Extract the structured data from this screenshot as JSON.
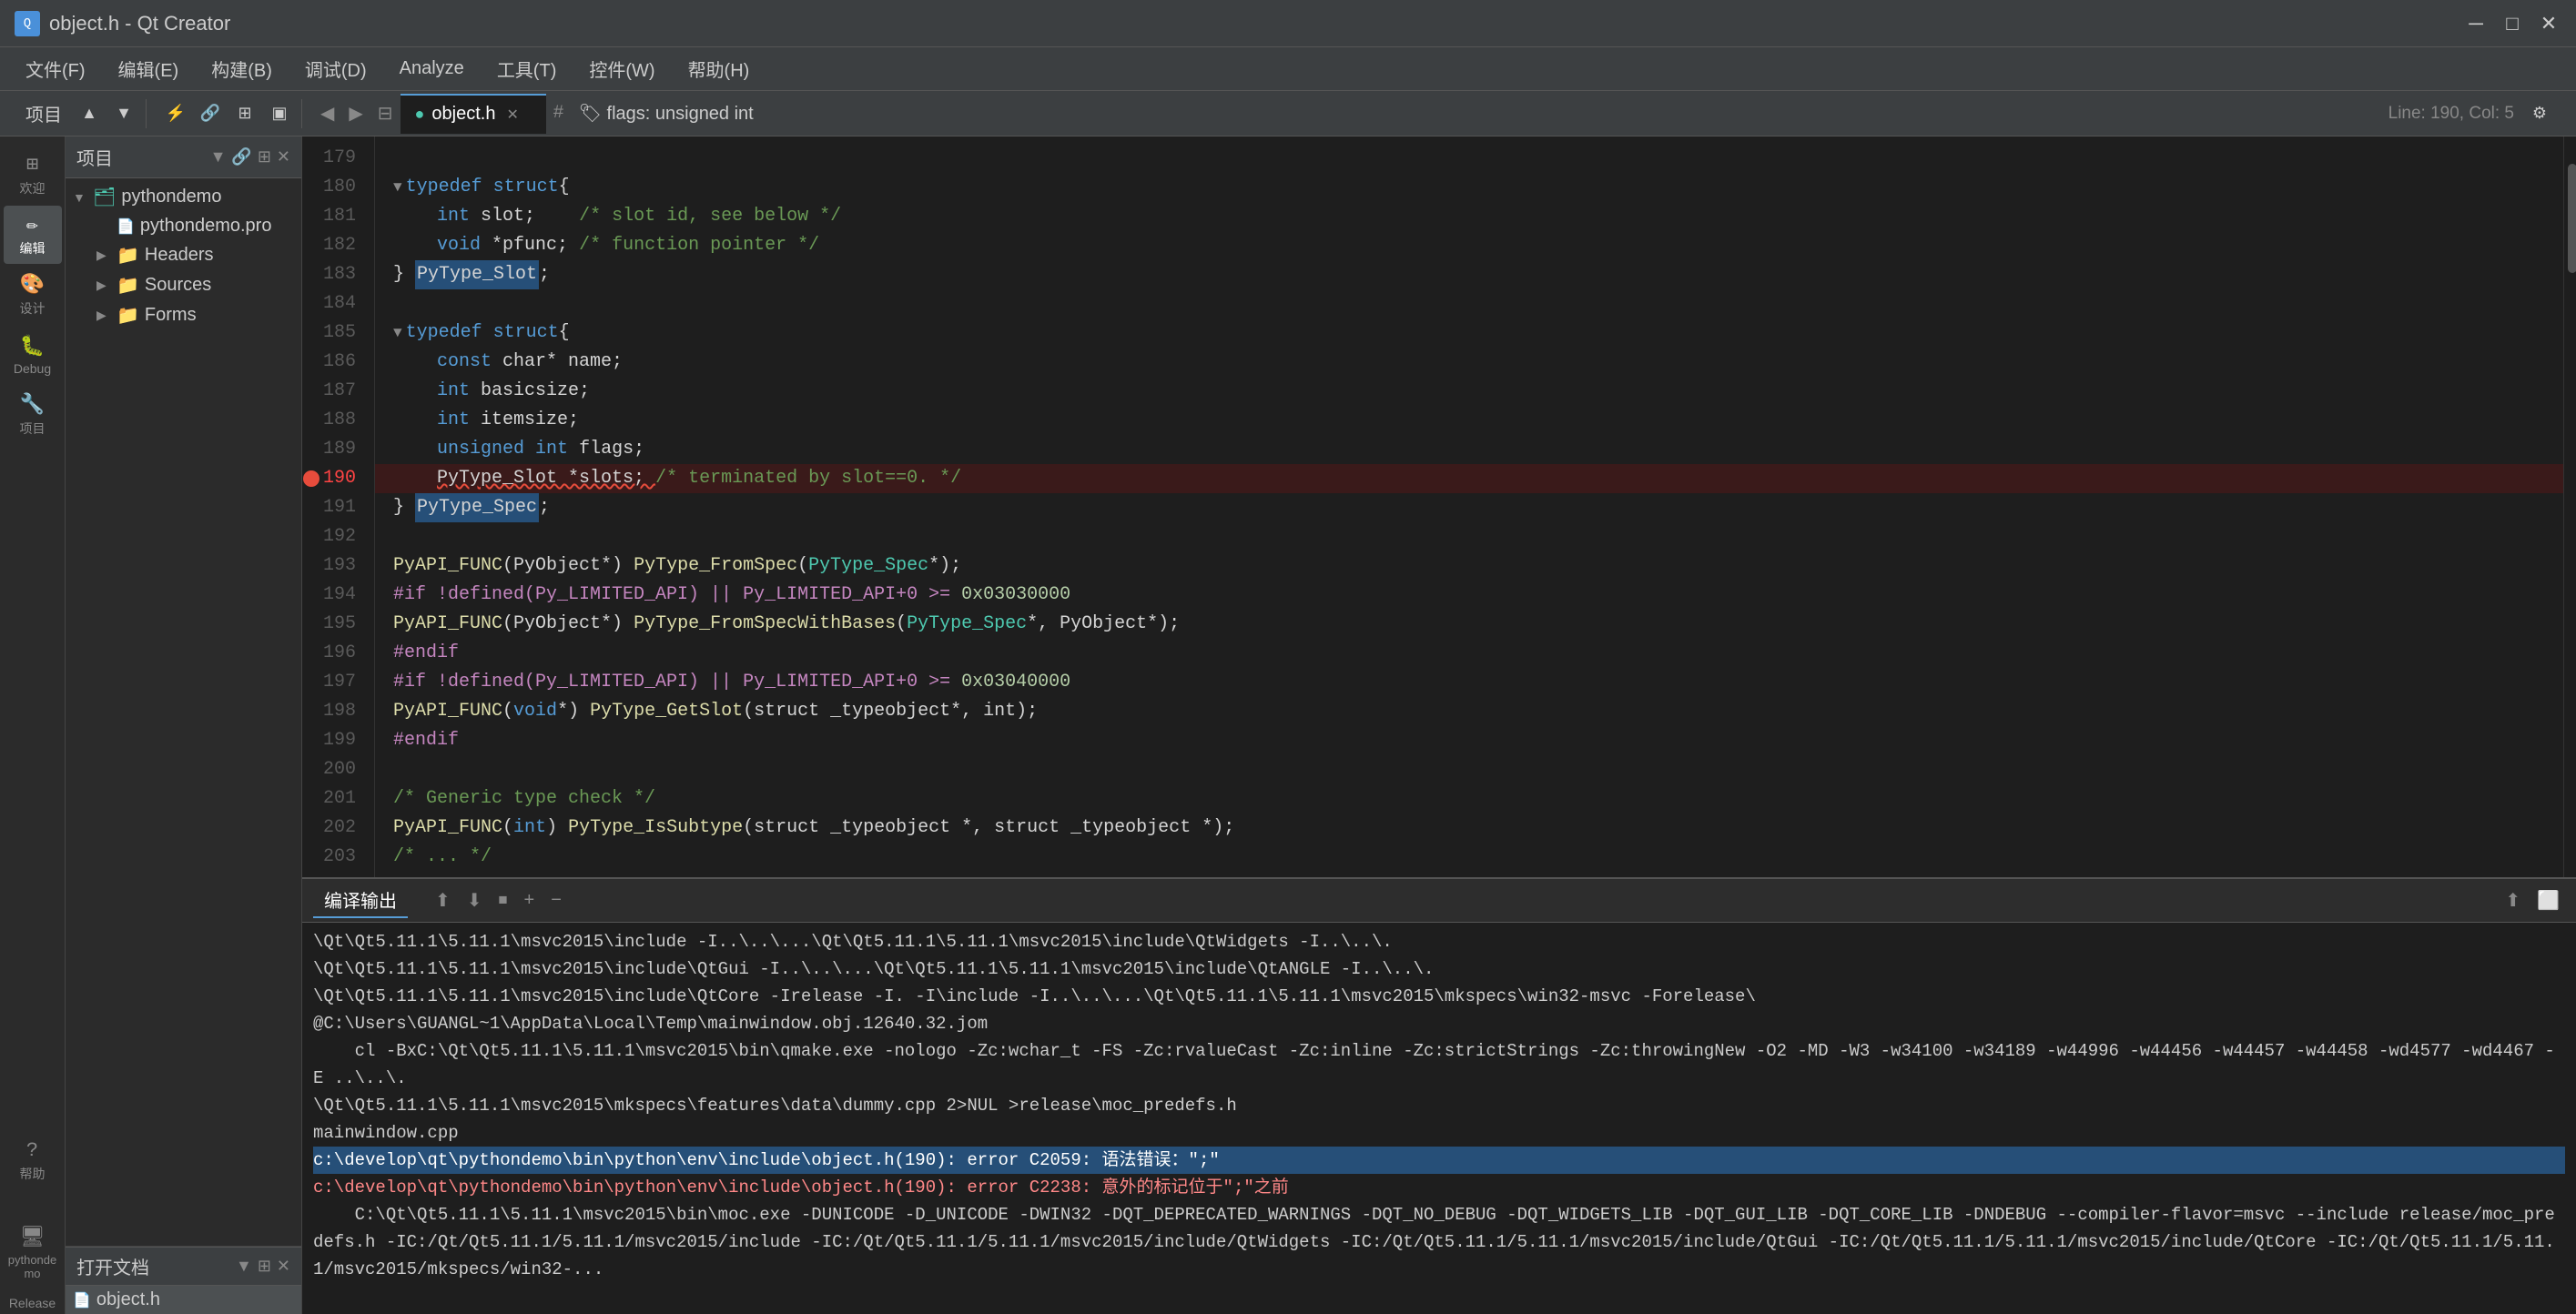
{
  "titleBar": {
    "icon": "●",
    "title": "object.h - Qt Creator",
    "controls": [
      "─",
      "□",
      "✕"
    ]
  },
  "menuBar": {
    "items": [
      "文件(F)",
      "编辑(E)",
      "构建(B)",
      "调试(D)",
      "Analyze",
      "工具(T)",
      "控件(W)",
      "帮助(H)"
    ]
  },
  "toolbar": {
    "project_selector": "项目",
    "tab_file": "object.h",
    "breadcrumb": "flags: unsigned int",
    "position": "Line: 190, Col: 5"
  },
  "activityBar": {
    "items": [
      {
        "icon": "⊞",
        "label": "欢迎",
        "active": false
      },
      {
        "icon": "✏",
        "label": "编辑",
        "active": true
      },
      {
        "icon": "🎨",
        "label": "设计",
        "active": false
      },
      {
        "icon": "🐛",
        "label": "Debug",
        "active": false
      },
      {
        "icon": "🔧",
        "label": "项目",
        "active": false
      },
      {
        "icon": "?",
        "label": "帮助",
        "active": false
      }
    ],
    "bottom": "pythondemo"
  },
  "projectPanel": {
    "title": "项目",
    "tree": [
      {
        "indent": 0,
        "arrow": "▼",
        "icon": "folder",
        "label": "pythondemo",
        "type": "root"
      },
      {
        "indent": 1,
        "arrow": " ",
        "icon": "pro",
        "label": "pythondemo.pro",
        "type": "file"
      },
      {
        "indent": 1,
        "arrow": "▶",
        "icon": "folder",
        "label": "Headers",
        "type": "folder"
      },
      {
        "indent": 1,
        "arrow": "▶",
        "icon": "folder",
        "label": "Sources",
        "type": "folder"
      },
      {
        "indent": 1,
        "arrow": "▶",
        "icon": "folder",
        "label": "Forms",
        "type": "folder"
      }
    ]
  },
  "openFiles": {
    "title": "打开文档",
    "files": [
      "object.h"
    ]
  },
  "codeLines": [
    {
      "num": 179,
      "content": "",
      "tokens": []
    },
    {
      "num": 180,
      "fold": true,
      "content": "typedef struct{",
      "tokens": [
        {
          "text": "typedef ",
          "class": "kw"
        },
        {
          "text": "struct",
          "class": "kw"
        },
        {
          "text": "{",
          "class": ""
        }
      ]
    },
    {
      "num": 181,
      "content": "    int slot;    /* slot id, see below */",
      "tokens": [
        {
          "text": "    ",
          "class": ""
        },
        {
          "text": "int",
          "class": "kw"
        },
        {
          "text": " slot;    ",
          "class": ""
        },
        {
          "text": "/* slot id, see below */",
          "class": "cmt"
        }
      ]
    },
    {
      "num": 182,
      "content": "    void *pfunc; /* function pointer */",
      "tokens": [
        {
          "text": "    ",
          "class": ""
        },
        {
          "text": "void",
          "class": "kw"
        },
        {
          "text": " *pfunc; ",
          "class": ""
        },
        {
          "text": "/* function pointer */",
          "class": "cmt"
        }
      ]
    },
    {
      "num": 183,
      "content": "} PyType_Slot;",
      "tokens": [
        {
          "text": "} ",
          "class": ""
        },
        {
          "text": "PyType_Slot",
          "class": "hl"
        },
        {
          "text": ";",
          "class": ""
        }
      ]
    },
    {
      "num": 184,
      "content": "",
      "tokens": []
    },
    {
      "num": 185,
      "fold": true,
      "content": "typedef struct{",
      "tokens": [
        {
          "text": "typedef ",
          "class": "kw"
        },
        {
          "text": "struct",
          "class": "kw"
        },
        {
          "text": "{",
          "class": ""
        }
      ]
    },
    {
      "num": 186,
      "content": "    const char* name;",
      "tokens": [
        {
          "text": "    ",
          "class": ""
        },
        {
          "text": "const",
          "class": "kw"
        },
        {
          "text": " char* name;",
          "class": ""
        }
      ]
    },
    {
      "num": 187,
      "content": "    int basicsize;",
      "tokens": [
        {
          "text": "    ",
          "class": ""
        },
        {
          "text": "int",
          "class": "kw"
        },
        {
          "text": " basicsize;",
          "class": ""
        }
      ]
    },
    {
      "num": 188,
      "content": "    int itemsize;",
      "tokens": [
        {
          "text": "    ",
          "class": ""
        },
        {
          "text": "int",
          "class": "kw"
        },
        {
          "text": " itemsize;",
          "class": ""
        }
      ]
    },
    {
      "num": 189,
      "content": "    unsigned int flags;",
      "tokens": [
        {
          "text": "    ",
          "class": ""
        },
        {
          "text": "unsigned",
          "class": "kw"
        },
        {
          "text": " ",
          "class": ""
        },
        {
          "text": "int",
          "class": "kw"
        },
        {
          "text": " flags;",
          "class": ""
        }
      ]
    },
    {
      "num": 190,
      "error": true,
      "content": "    PyType_Slot *slots; /* terminated by slot==0. */",
      "tokens": [
        {
          "text": "    PyType_Slot *slots; ",
          "class": "underline"
        },
        {
          "text": "/* terminated by slot==0. */",
          "class": "cmt"
        }
      ]
    },
    {
      "num": 191,
      "content": "} PyType_Spec;",
      "tokens": [
        {
          "text": "} ",
          "class": ""
        },
        {
          "text": "PyType_Spec",
          "class": "hl"
        },
        {
          "text": ";",
          "class": ""
        }
      ]
    },
    {
      "num": 192,
      "content": "",
      "tokens": []
    },
    {
      "num": 193,
      "content": "PyAPI_FUNC(PyObject*) PyType_FromSpec(PyType_Spec*);",
      "tokens": [
        {
          "text": "PyAPI_FUNC",
          "class": "fn"
        },
        {
          "text": "(PyObject*) ",
          "class": ""
        },
        {
          "text": "PyType_FromSpec",
          "class": "fn"
        },
        {
          "text": "(",
          "class": ""
        },
        {
          "text": "PyType_Spec",
          "class": "type"
        },
        {
          "text": "*);",
          "class": ""
        }
      ]
    },
    {
      "num": 194,
      "content": "#if !defined(Py_LIMITED_API) || Py_LIMITED_API+0 >= 0x03030000",
      "tokens": [
        {
          "text": "#if !defined(Py_LIMITED_API) || Py_LIMITED_API+0 >= ",
          "class": "pp"
        },
        {
          "text": "0x03030000",
          "class": "num"
        }
      ]
    },
    {
      "num": 195,
      "content": "PyAPI_FUNC(PyObject*) PyType_FromSpecWithBases(PyType_Spec*, PyObject*);",
      "tokens": [
        {
          "text": "PyAPI_FUNC",
          "class": "fn"
        },
        {
          "text": "(PyObject*) ",
          "class": ""
        },
        {
          "text": "PyType_FromSpecWithBases",
          "class": "fn"
        },
        {
          "text": "(",
          "class": ""
        },
        {
          "text": "PyType_Spec",
          "class": "type"
        },
        {
          "text": "*, PyObject*);",
          "class": ""
        }
      ]
    },
    {
      "num": 196,
      "content": "#endif",
      "tokens": [
        {
          "text": "#endif",
          "class": "pp"
        }
      ]
    },
    {
      "num": 197,
      "content": "#if !defined(Py_LIMITED_API) || Py_LIMITED_API+0 >= 0x03040000",
      "tokens": [
        {
          "text": "#if !defined(Py_LIMITED_API) || Py_LIMITED_API+0 >= ",
          "class": "pp"
        },
        {
          "text": "0x03040000",
          "class": "num"
        }
      ]
    },
    {
      "num": 198,
      "content": "PyAPI_FUNC(void*) PyType_GetSlot(struct _typeobject*, int);",
      "tokens": [
        {
          "text": "PyAPI_FUNC",
          "class": "fn"
        },
        {
          "text": "(",
          "class": ""
        },
        {
          "text": "void",
          "class": "kw"
        },
        {
          "text": "*) ",
          "class": ""
        },
        {
          "text": "PyType_GetSlot",
          "class": "fn"
        },
        {
          "text": "(struct _typeobject*, int);",
          "class": ""
        }
      ]
    },
    {
      "num": 199,
      "content": "#endif",
      "tokens": [
        {
          "text": "#endif",
          "class": "pp"
        }
      ]
    },
    {
      "num": 200,
      "content": "",
      "tokens": []
    },
    {
      "num": 201,
      "content": "/* Generic type check */",
      "tokens": [
        {
          "text": "/* Generic type check */",
          "class": "cmt"
        }
      ]
    },
    {
      "num": 202,
      "content": "PyAPI_FUNC(int) PyType_IsSubtype(struct _typeobject *, struct _typeobject *);",
      "tokens": [
        {
          "text": "PyAPI_FUNC",
          "class": "fn"
        },
        {
          "text": "(",
          "class": ""
        },
        {
          "text": "int",
          "class": "kw"
        },
        {
          "text": ") ",
          "class": ""
        },
        {
          "text": "PyType_IsSubtype",
          "class": "fn"
        },
        {
          "text": "(struct _typeobject *, struct _typeobject *);",
          "class": ""
        }
      ]
    },
    {
      "num": 203,
      "content": "...",
      "tokens": [
        {
          "text": "...",
          "class": "cmt"
        }
      ]
    }
  ],
  "buildOutput": {
    "tabLabel": "编译输出",
    "lines": [
      "\\Qt\\Qt5.11.1\\5.11.1\\msvc2015\\include -I..\\..\\..\\Qt\\Qt5.11.1\\5.11.1\\msvc2015\\include\\QtWidgets -I..\\..\\.",
      "\\Qt\\Qt5.11.1\\5.11.1\\msvc2015\\include\\QtGui -I..\\..\\..\\Qt\\Qt5.11.1\\5.11.1\\msvc2015\\include\\QtANGLE -I..\\..\\.",
      "\\Qt\\Qt5.11.1\\5.11.1\\msvc2015\\include\\QtCore -Irelease -I. -I\\include -I..\\..\\..\\Qt\\Qt5.11.1\\5.11.1\\msvc2015\\mkspecs\\win32-msvc -Forelease\\",
      "@C:\\Users\\GUANGL~1\\AppData\\Local\\Temp\\mainwindow.obj.12640.32.jom",
      "    cl -BxC:\\Qt\\Qt5.11.1\\5.11.1\\msvc2015\\bin\\qmake.exe -nologo -Zc:wchar_t -FS -Zc:rvalueCast -Zc:inline -Zc:strictStrings -Zc:throwingNew -O2 -MD -W3 -w34100 -w34189 -w44996 -w44456 -w44457 -w44458 -wd4577 -wd4467 -E ..\\..\\.",
      "\\Qt\\Qt5.11.1\\5.11.1\\msvc2015\\mkspecs\\features\\data\\dummy.cpp 2>NUL >release\\moc_predefs.h",
      "mainwindow.cpp",
      "c:\\develop\\qt\\pythondemo\\bin\\python\\env\\include\\object.h(190): error C2059: 语法错误:\";\"",
      "c:\\develop\\qt\\pythondemo\\bin\\python\\env\\include\\object.h(190): error C2238: 意外的标记位于\";\"之前",
      "    C:\\Qt\\Qt5.11.1\\5.11.1\\msvc2015\\bin\\moc.exe -DUNICODE -D_UNICODE -DWIN32 -DQT_DEPRECATED_WARNINGS -DQT_NO_DEBUG -DQT_WIDGETS_LIB -DQT_GUI_LIB -DQT_CORE_LIB -DNDEBUG --compiler-flavor=msvc --include release/moc_predefs.h -IC:/Qt/Qt5.11.1/5.11.1/msvc2015/include -IC:/Qt/Qt5.11.1/5.11.1/msvc2015/include/QtWidgets -IC:/Qt/Qt5.11.1/5.11.1/msvc2015/include/QtGui -IC:/Qt/Qt5.11.1/5.11.1/msvc2015/include/QtCore -IC:/Qt/Qt5.11.1/5.11.1/msvc2015/mkspecs/win32-..."
    ],
    "errorLineIdx": 7
  },
  "bottomBar": {
    "label": "Release"
  }
}
